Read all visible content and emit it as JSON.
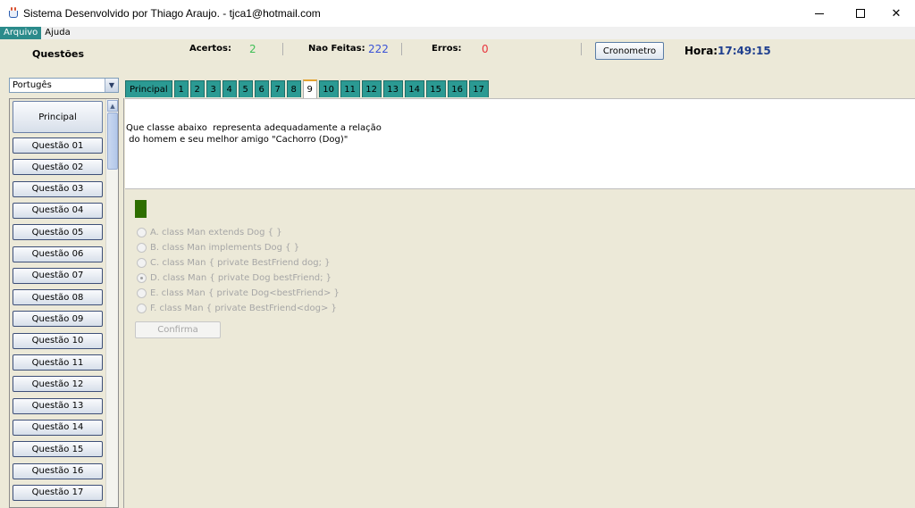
{
  "window": {
    "title": "Sistema Desenvolvido por Thiago Araujo. - tjca1@hotmail.com",
    "minimize": "—",
    "close": "✕"
  },
  "menu": {
    "items": [
      "Arquivo",
      "Ajuda"
    ],
    "active": "Arquivo"
  },
  "stats": {
    "questoes_label": "Questões",
    "acertos_label": "Acertos:",
    "acertos_value": "2",
    "nao_feitas_label": "Nao Feitas:",
    "nao_feitas_value": "222",
    "erros_label": "Erros:",
    "erros_value": "0",
    "cronometro_label": "Cronometro",
    "hora_label": "Hora:",
    "hora_value": "17:49:15"
  },
  "colors": {
    "acertos": "#3fbf56",
    "nao_feitas": "#3a52d6",
    "erros": "#e8323b",
    "tab": "#2b9a93",
    "menu_active": "#2b8b8b",
    "indicator": "#2e6e00"
  },
  "subject": {
    "selected": "Portugês"
  },
  "question_list": {
    "principal": "Principal",
    "items": [
      "Questão 01",
      "Questão 02",
      "Questão 03",
      "Questão 04",
      "Questão 05",
      "Questão 06",
      "Questão 07",
      "Questão 08",
      "Questão 09",
      "Questão 10",
      "Questão 11",
      "Questão 12",
      "Questão 13",
      "Questão 14",
      "Questão 15",
      "Questão 16",
      "Questão 17"
    ]
  },
  "tabs": {
    "items": [
      "Principal",
      "1",
      "2",
      "3",
      "4",
      "5",
      "6",
      "7",
      "8",
      "9",
      "10",
      "11",
      "12",
      "13",
      "14",
      "15",
      "16",
      "17"
    ],
    "active": "9"
  },
  "question": {
    "line1": "Que classe abaixo  representa adequadamente a relação",
    "line2": " do homem e seu melhor amigo \"Cachorro (Dog)\""
  },
  "options": [
    {
      "label": "A. class Man extends Dog { }",
      "checked": false
    },
    {
      "label": "B. class Man implements Dog { }",
      "checked": false
    },
    {
      "label": "C. class Man { private BestFriend dog; }",
      "checked": false
    },
    {
      "label": "D. class Man { private Dog bestFriend; }",
      "checked": true
    },
    {
      "label": "E. class Man { private Dog<bestFriend> }",
      "checked": false
    },
    {
      "label": "F. class Man { private BestFriend<dog> }",
      "checked": false
    }
  ],
  "confirm_label": "Confirma"
}
